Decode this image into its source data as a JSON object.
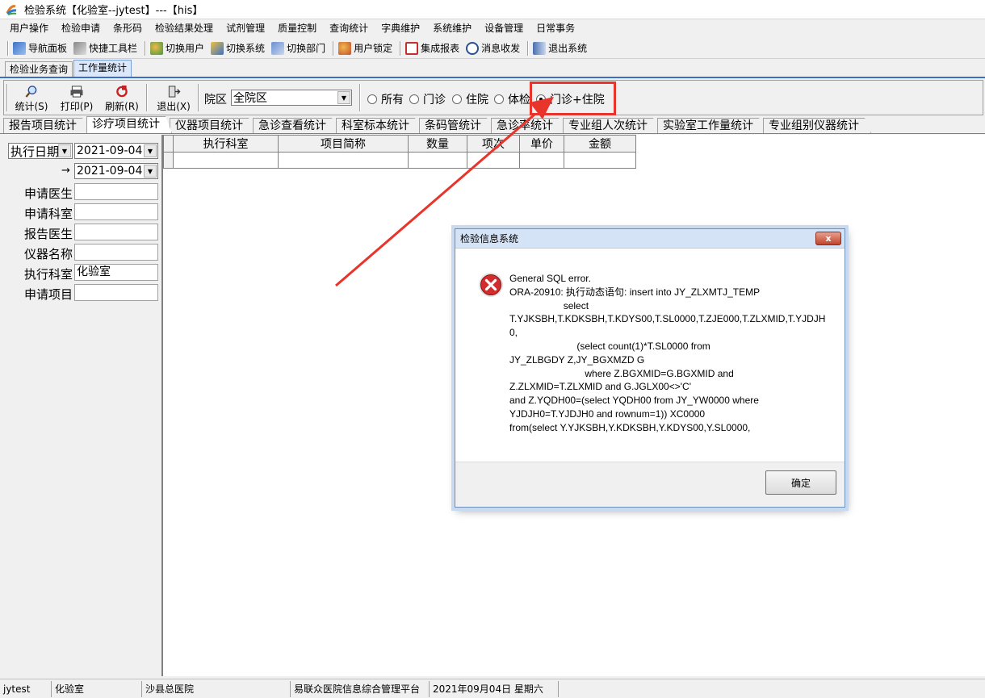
{
  "window": {
    "title": "检验系统【化验室--jytest】---【his】"
  },
  "menu": [
    "用户操作",
    "检验申请",
    "条形码",
    "检验结果处理",
    "试剂管理",
    "质量控制",
    "查询统计",
    "字典维护",
    "系统维护",
    "设备管理",
    "日常事务"
  ],
  "toolbar": {
    "nav_panel": "导航面板",
    "quick_toolbar": "快捷工具栏",
    "switch_user": "切换用户",
    "switch_system": "切换系统",
    "switch_dept": "切换部门",
    "user_lock": "用户锁定",
    "report": "集成报表",
    "messages": "消息收发",
    "exit": "退出系统"
  },
  "main_tabs": [
    "检验业务查询",
    "工作量统计"
  ],
  "panel": {
    "stat_label": "统计(S)",
    "print_label": "打印(P)",
    "refresh_label": "刷新(R)",
    "exit_label": "退出(X)",
    "district_label": "院区",
    "district_value": "全院区",
    "radios": [
      {
        "label": "所有",
        "checked": false
      },
      {
        "label": "门诊",
        "checked": false
      },
      {
        "label": "住院",
        "checked": false
      },
      {
        "label": "体检",
        "checked": false
      },
      {
        "label": "门诊+住院",
        "checked": true
      }
    ]
  },
  "sub_tabs": [
    "报告项目统计",
    "诊疗项目统计",
    "仪器项目统计",
    "急诊查看统计",
    "科室标本统计",
    "条码管统计",
    "急诊率统计",
    "专业组人次统计",
    "实验室工作量统计",
    "专业组别仪器统计"
  ],
  "filters": {
    "date_type": "执行日期",
    "date_from": "2021-09-04",
    "date_arrow": "→",
    "date_to": "2021-09-04",
    "fields": [
      {
        "label": "申请医生",
        "value": ""
      },
      {
        "label": "申请科室",
        "value": ""
      },
      {
        "label": "报告医生",
        "value": ""
      },
      {
        "label": "仪器名称",
        "value": ""
      },
      {
        "label": "执行科室",
        "value": "化验室"
      },
      {
        "label": "申请项目",
        "value": ""
      }
    ]
  },
  "grid": {
    "columns": [
      "执行科室",
      "项目简称",
      "数量",
      "项次",
      "单价",
      "金额"
    ]
  },
  "dialog": {
    "title": "检验信息系统",
    "close": "x",
    "message": "General SQL error.\nORA-20910: 执行动态语句: insert into JY_ZLXMTJ_TEMP\n                    select\nT.YJKSBH,T.KDKSBH,T.KDYS00,T.SL0000,T.ZJE000,T.ZLXMID,T.YJDJH0,\n                         (select count(1)*T.SL0000 from\nJY_ZLBGDY Z,JY_BGXMZD G\n                            where Z.BGXMID=G.BGXMID and\nZ.ZLXMID=T.ZLXMID and G.JGLX00<>'C'\nand Z.YQDH00=(select YQDH00 from JY_YW0000 where\nYJDJH0=T.YJDJH0 and rownum=1)) XC0000\nfrom(select Y.YJKSBH,Y.KDKSBH,Y.KDYS00,Y.SL0000,",
    "ok": "确定"
  },
  "status": [
    "jytest",
    "化验室",
    "沙县总医院",
    "易联众医院信息综合管理平台",
    "2021年09月04日 星期六"
  ],
  "annotation_color": "#e8342a"
}
